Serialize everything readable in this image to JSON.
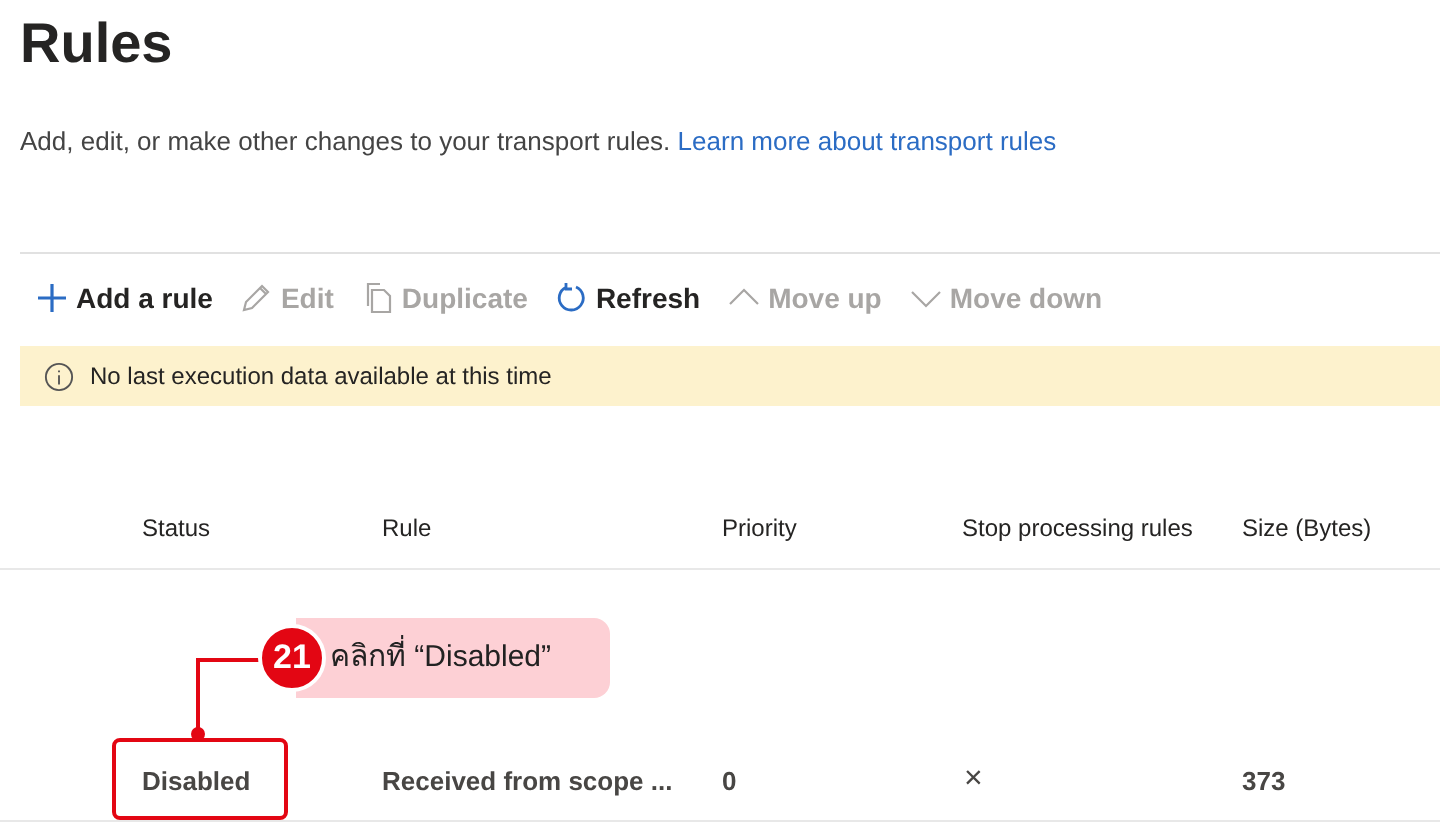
{
  "title": "Rules",
  "description": {
    "text": "Add, edit, or make other changes to your transport rules.",
    "link": "Learn more about transport rules"
  },
  "toolbar": [
    {
      "kind": "add",
      "label": "Add a rule",
      "disabled": false
    },
    {
      "kind": "edit",
      "label": "Edit",
      "disabled": true
    },
    {
      "kind": "duplicate",
      "label": "Duplicate",
      "disabled": true
    },
    {
      "kind": "refresh",
      "label": "Refresh",
      "disabled": false
    },
    {
      "kind": "up",
      "label": "Move up",
      "disabled": true
    },
    {
      "kind": "down",
      "label": "Move down",
      "disabled": true
    }
  ],
  "banner": {
    "text": "No last execution data available at this time"
  },
  "table": {
    "columns": [
      "Status",
      "Rule",
      "Priority",
      "Stop processing rules",
      "Size (Bytes)"
    ],
    "rows": [
      {
        "status": "Disabled",
        "rule": "Received from scope ...",
        "priority": "0",
        "stop_processing": "×",
        "size": "373"
      }
    ]
  },
  "annotation": {
    "number": "21",
    "text": "คลิกที่ “Disabled”"
  }
}
